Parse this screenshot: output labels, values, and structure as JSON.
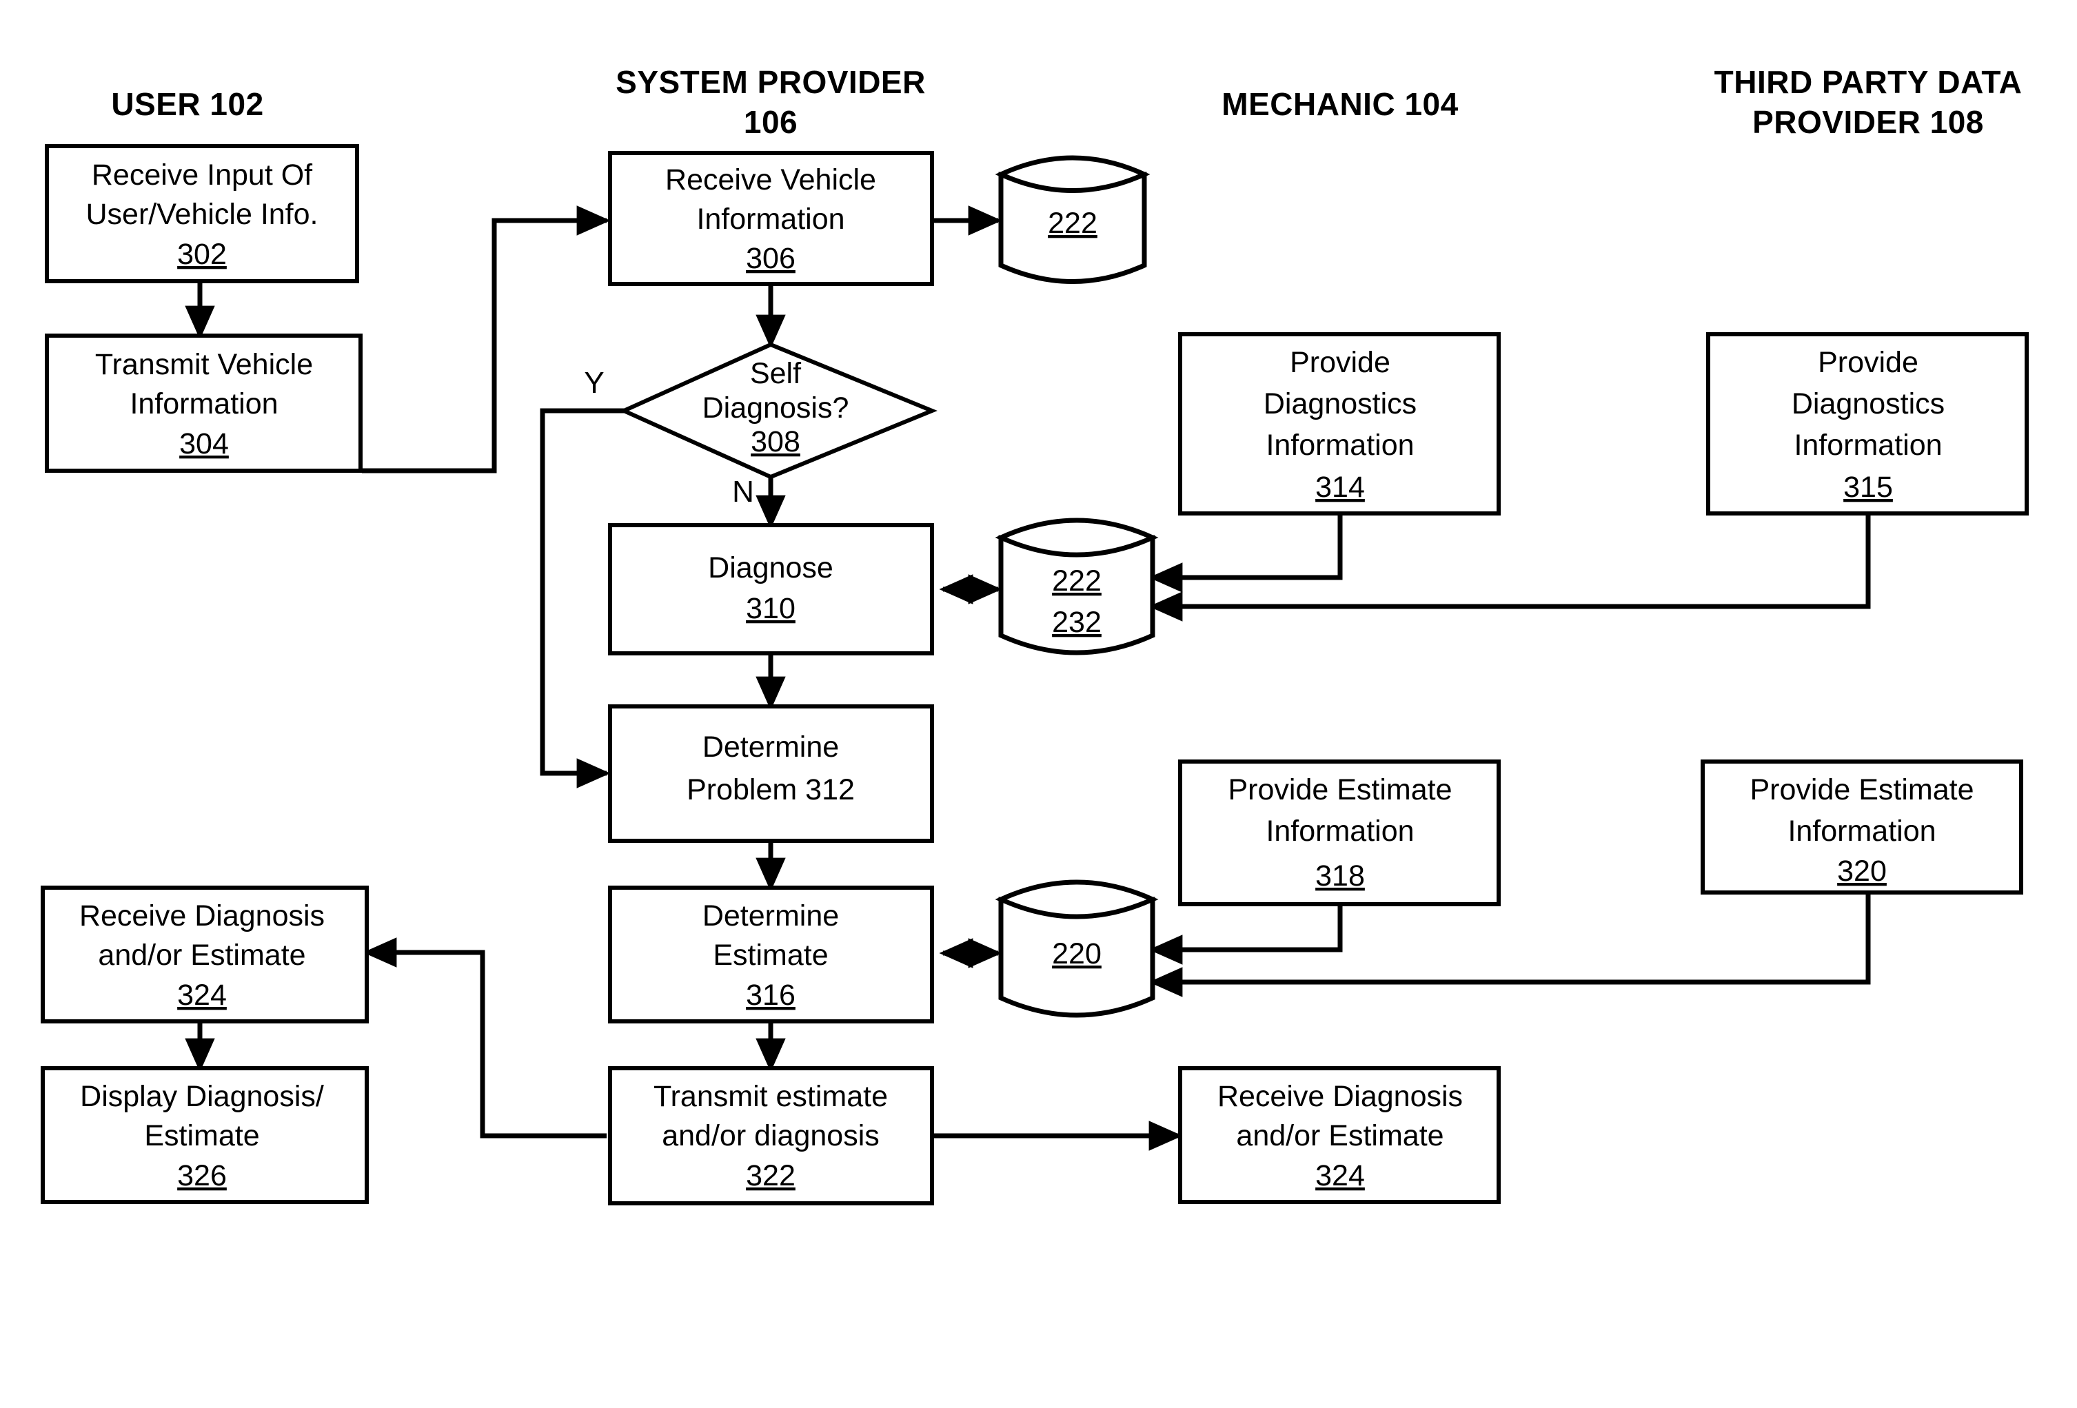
{
  "figure": {
    "type": "flowchart",
    "background": "#ffffff",
    "line_color": "#000000"
  },
  "columns": [
    {
      "id": "user",
      "label_line1": "USER 102",
      "label_line2": ""
    },
    {
      "id": "system_provider",
      "label_line1": "SYSTEM PROVIDER",
      "label_line2": "106"
    },
    {
      "id": "mechanic",
      "label_line1": "MECHANIC 104",
      "label_line2": ""
    },
    {
      "id": "third_party",
      "label_line1": "THIRD PARTY DATA",
      "label_line2": "PROVIDER 108"
    }
  ],
  "nodes": {
    "n302": {
      "shape": "process",
      "lines": [
        "Receive Input Of",
        "User/Vehicle Info."
      ],
      "ref": "302",
      "column": "user"
    },
    "n304": {
      "shape": "process",
      "lines": [
        "Transmit Vehicle",
        "Information"
      ],
      "ref": "304",
      "column": "user"
    },
    "n306": {
      "shape": "process",
      "lines": [
        "Receive Vehicle",
        "Information"
      ],
      "ref": "306",
      "column": "system_provider"
    },
    "n308": {
      "shape": "decision",
      "lines": [
        "Self",
        "Diagnosis?"
      ],
      "ref": "308",
      "column": "system_provider"
    },
    "n310": {
      "shape": "process",
      "lines": [
        "Diagnose"
      ],
      "ref": "310",
      "column": "system_provider"
    },
    "n312": {
      "shape": "process",
      "lines": [
        "Determine",
        "Problem 312"
      ],
      "ref": "",
      "column": "system_provider"
    },
    "n316": {
      "shape": "process",
      "lines": [
        "Determine",
        "Estimate"
      ],
      "ref": "316",
      "column": "system_provider"
    },
    "n322": {
      "shape": "process",
      "lines": [
        "Transmit estimate",
        "and/or diagnosis"
      ],
      "ref": "322",
      "column": "system_provider"
    },
    "n324_user": {
      "shape": "process",
      "lines": [
        "Receive Diagnosis",
        "and/or Estimate"
      ],
      "ref": "324",
      "column": "user"
    },
    "n326": {
      "shape": "process",
      "lines": [
        "Display Diagnosis/",
        "Estimate"
      ],
      "ref": "326",
      "column": "user"
    },
    "n314": {
      "shape": "process",
      "lines": [
        "Provide",
        "Diagnostics",
        "Information"
      ],
      "ref": "314",
      "column": "mechanic"
    },
    "n318": {
      "shape": "process",
      "lines": [
        "Provide Estimate",
        "Information"
      ],
      "ref": "318",
      "column": "mechanic"
    },
    "n324_mech": {
      "shape": "process",
      "lines": [
        "Receive Diagnosis",
        "and/or Estimate"
      ],
      "ref": "324",
      "column": "mechanic"
    },
    "n315": {
      "shape": "process",
      "lines": [
        "Provide",
        "Diagnostics",
        "Information"
      ],
      "ref": "315",
      "column": "third_party"
    },
    "n320": {
      "shape": "process",
      "lines": [
        "Provide Estimate",
        "Information"
      ],
      "ref": "320",
      "column": "third_party"
    },
    "db222": {
      "shape": "database",
      "ref_lines": [
        "222"
      ]
    },
    "db222_232": {
      "shape": "database",
      "ref_lines": [
        "222",
        "232"
      ]
    },
    "db220": {
      "shape": "database",
      "ref_lines": [
        "220"
      ]
    }
  },
  "branch_labels": {
    "yes": "Y",
    "no": "N"
  },
  "edges": [
    {
      "from": "n302",
      "to": "n304",
      "kind": "arrow"
    },
    {
      "from": "n304",
      "to": "n306",
      "kind": "arrow"
    },
    {
      "from": "n306",
      "to": "db222",
      "kind": "arrow"
    },
    {
      "from": "n306",
      "to": "n308",
      "kind": "arrow"
    },
    {
      "from": "n308",
      "to": "n312",
      "kind": "arrow",
      "label": "Y"
    },
    {
      "from": "n308",
      "to": "n310",
      "kind": "arrow",
      "label": "N"
    },
    {
      "from": "n310",
      "to": "db222_232",
      "kind": "double-arrow"
    },
    {
      "from": "n310",
      "to": "n312",
      "kind": "arrow"
    },
    {
      "from": "n312",
      "to": "n316",
      "kind": "arrow"
    },
    {
      "from": "n316",
      "to": "db220",
      "kind": "double-arrow"
    },
    {
      "from": "n316",
      "to": "n322",
      "kind": "arrow"
    },
    {
      "from": "n314",
      "to": "db222_232",
      "kind": "arrow"
    },
    {
      "from": "n315",
      "to": "db222_232",
      "kind": "arrow"
    },
    {
      "from": "n318",
      "to": "db220",
      "kind": "arrow"
    },
    {
      "from": "n320",
      "to": "db220",
      "kind": "arrow"
    },
    {
      "from": "n322",
      "to": "n324_user",
      "kind": "arrow"
    },
    {
      "from": "n322",
      "to": "n324_mech",
      "kind": "arrow"
    },
    {
      "from": "n324_user",
      "to": "n326",
      "kind": "arrow"
    }
  ]
}
